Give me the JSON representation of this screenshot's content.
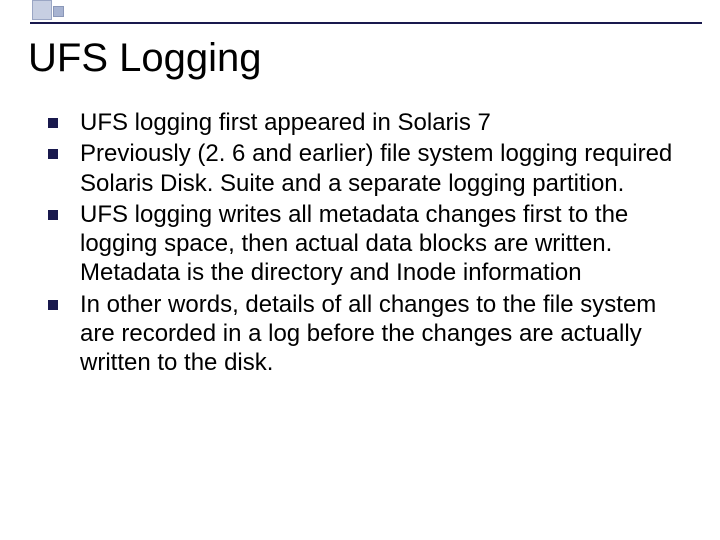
{
  "title": "UFS Logging",
  "bullets": [
    "UFS logging first appeared in Solaris 7",
    "Previously (2. 6 and earlier) file system logging required Solaris Disk. Suite and a separate logging partition.",
    "UFS logging writes all metadata changes first to the logging space, then actual data blocks are written. Metadata is the directory and Inode information",
    "In other words, details of all changes to the file system are recorded in a log before the changes are actually written to the disk."
  ]
}
